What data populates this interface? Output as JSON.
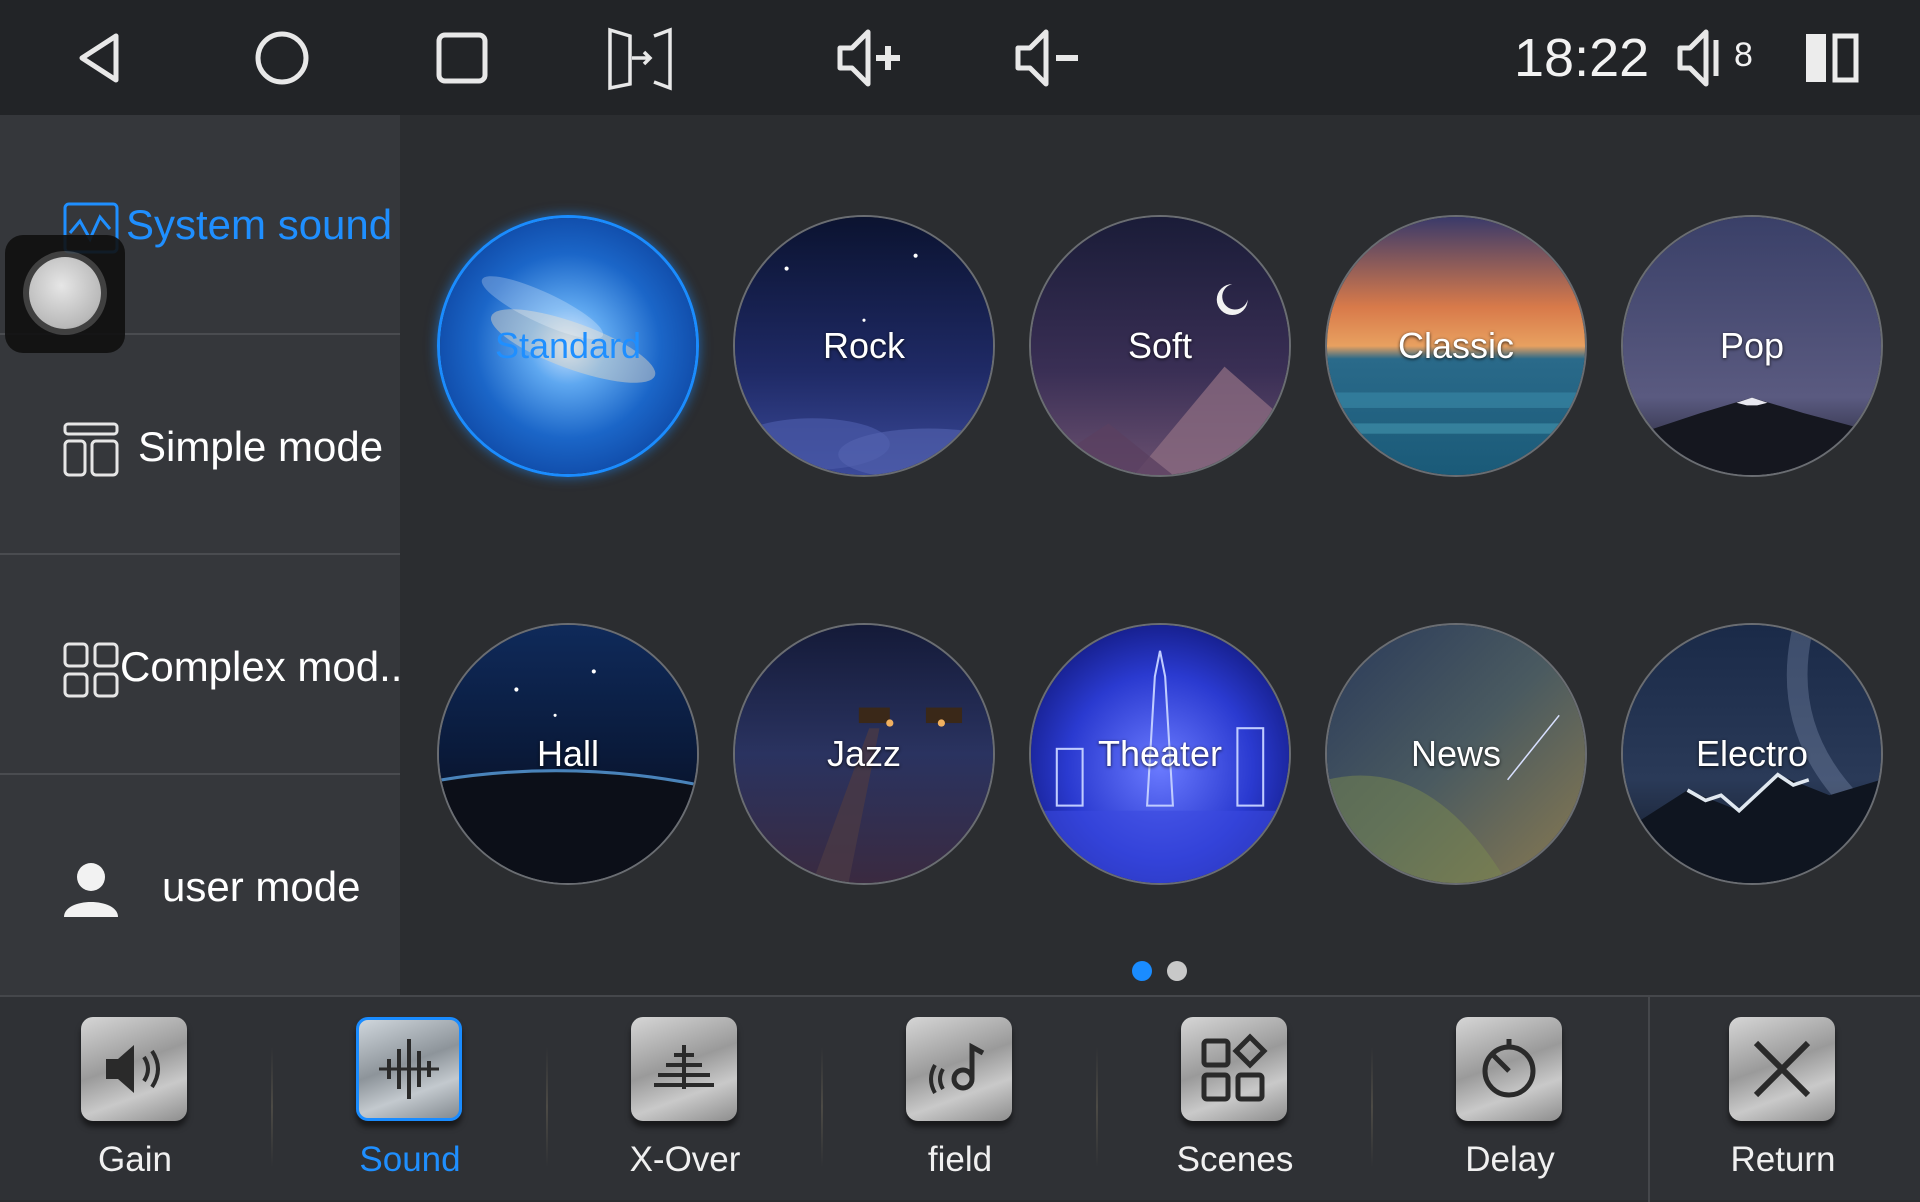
{
  "status_bar": {
    "time": "18:22",
    "volume_level": "8"
  },
  "sidebar": {
    "items": [
      {
        "label": "System sound",
        "icon": "waveform-icon",
        "active": true
      },
      {
        "label": "Simple mode",
        "icon": "layout-icon",
        "active": false
      },
      {
        "label": "Complex mod..",
        "icon": "grid-icon",
        "active": false
      },
      {
        "label": "user mode",
        "icon": "person-icon",
        "active": false
      }
    ]
  },
  "presets": [
    {
      "label": "Standard",
      "selected": true
    },
    {
      "label": "Rock",
      "selected": false
    },
    {
      "label": "Soft",
      "selected": false
    },
    {
      "label": "Classic",
      "selected": false
    },
    {
      "label": "Pop",
      "selected": false
    },
    {
      "label": "Hall",
      "selected": false
    },
    {
      "label": "Jazz",
      "selected": false
    },
    {
      "label": "Theater",
      "selected": false
    },
    {
      "label": "News",
      "selected": false
    },
    {
      "label": "Electro",
      "selected": false
    }
  ],
  "pagination": {
    "pages": 2,
    "current": 1
  },
  "tabs": [
    {
      "label": "Gain",
      "icon": "speaker-icon",
      "active": false
    },
    {
      "label": "Sound",
      "icon": "soundwave-icon",
      "active": true
    },
    {
      "label": "X-Over",
      "icon": "sliders-icon",
      "active": false
    },
    {
      "label": "field",
      "icon": "music-note-icon",
      "active": false
    },
    {
      "label": "Scenes",
      "icon": "scenes-icon",
      "active": false
    },
    {
      "label": "Delay",
      "icon": "timer-icon",
      "active": false
    },
    {
      "label": "Return",
      "icon": "close-icon",
      "active": false
    }
  ],
  "colors": {
    "accent": "#1a8cff",
    "background": "#2b2d30",
    "sidebar": "#35373b"
  }
}
